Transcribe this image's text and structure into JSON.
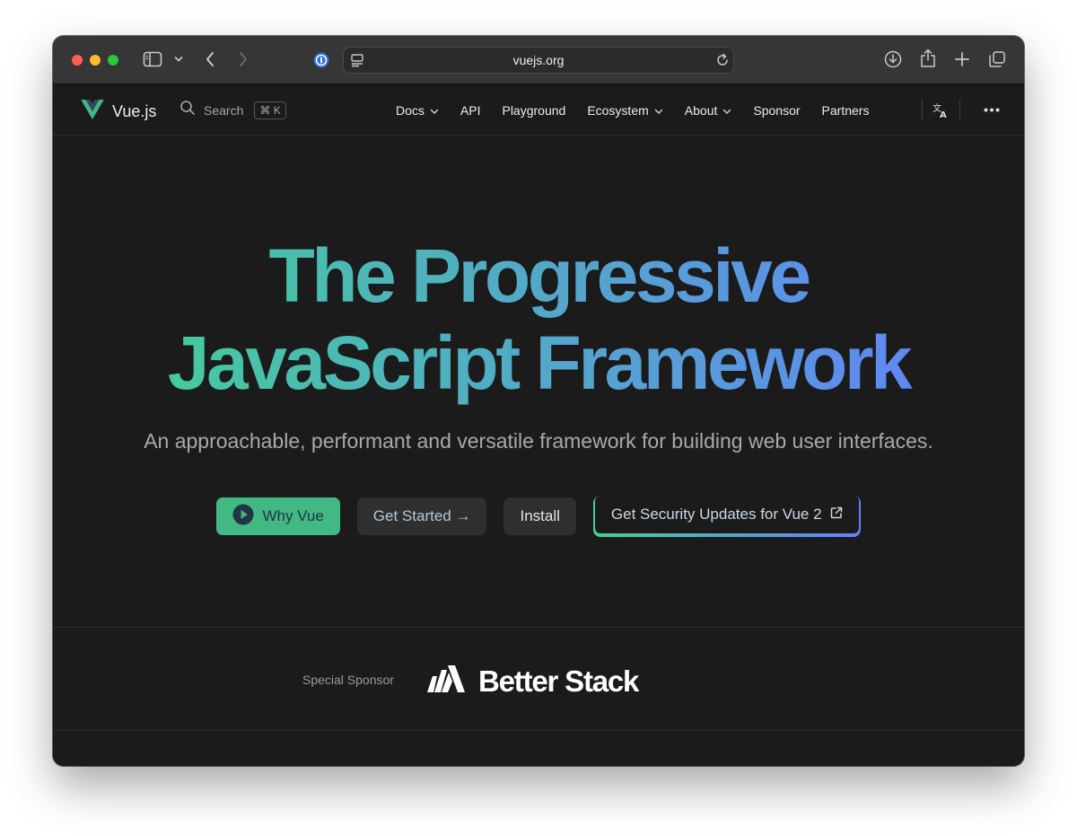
{
  "browser": {
    "url": "vuejs.org",
    "icons": [
      "sidebar-icon",
      "chevron-down-icon",
      "back-icon",
      "forward-icon",
      "password-icon",
      "page-menu-icon",
      "reload-icon",
      "download-icon",
      "share-icon",
      "new-tab-icon",
      "tab-overview-icon"
    ]
  },
  "nav": {
    "logo_text": "Vue.js",
    "search_label": "Search",
    "search_shortcut": "⌘ K",
    "links": {
      "docs": "Docs",
      "api": "API",
      "playground": "Playground",
      "ecosystem": "Ecosystem",
      "about": "About",
      "sponsor": "Sponsor",
      "partners": "Partners"
    }
  },
  "hero": {
    "title_line1": "The Progressive",
    "title_line2": "JavaScript Framework",
    "tagline": "An approachable, performant and versatile framework for building web user interfaces.",
    "buttons": {
      "why_vue": "Why Vue",
      "get_started": "Get Started →",
      "install": "Install",
      "security": "Get Security Updates for Vue 2"
    }
  },
  "sponsor": {
    "label": "Special Sponsor",
    "brand": "Better Stack"
  },
  "colors": {
    "brand_green": "#42b883",
    "gradient_start": "#42d392",
    "gradient_end": "#647eff",
    "background": "#1b1b1b"
  }
}
